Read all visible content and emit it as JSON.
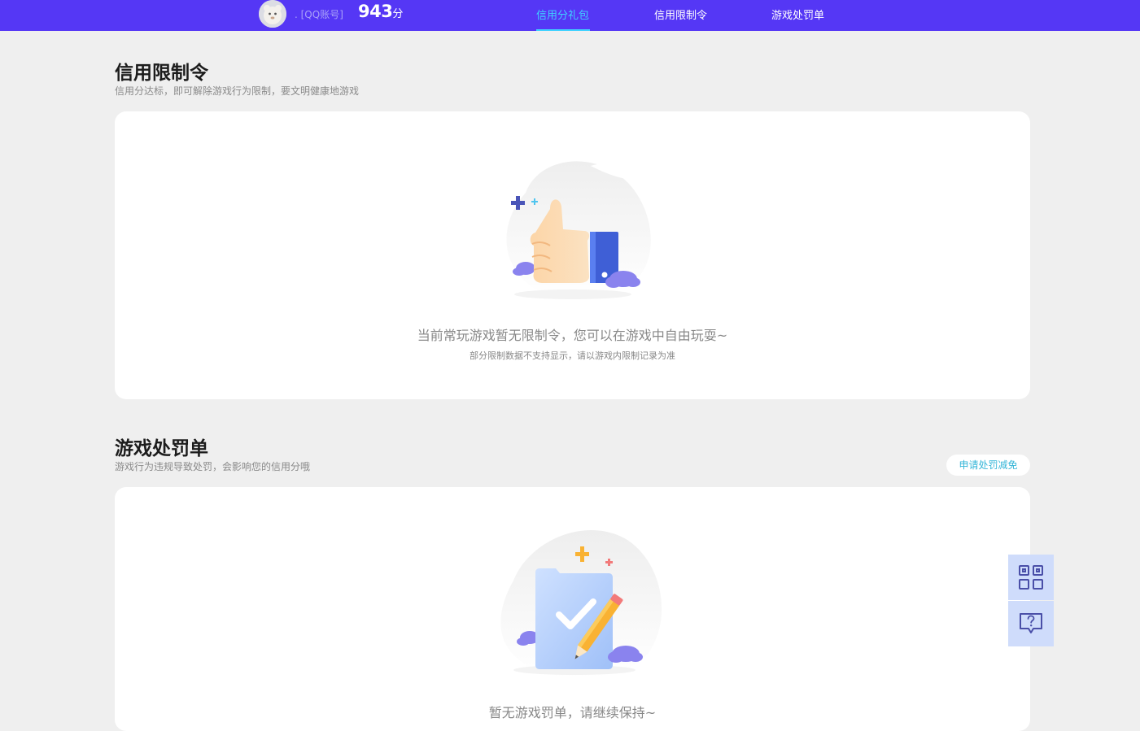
{
  "header": {
    "account_label": ". [QQ账号]",
    "score": "943",
    "score_unit": "分",
    "nav": [
      {
        "label": "信用分礼包",
        "active": true
      },
      {
        "label": "信用限制令",
        "active": false
      },
      {
        "label": "游戏处罚单",
        "active": false
      }
    ]
  },
  "restriction": {
    "title": "信用限制令",
    "subtitle": "信用分达标，即可解除游戏行为限制，要文明健康地游戏",
    "empty_message": "当前常玩游戏暂无限制令，您可以在游戏中自由玩耍~",
    "empty_note": "部分限制数据不支持显示，请以游戏内限制记录为准"
  },
  "penalty": {
    "title": "游戏处罚单",
    "subtitle": "游戏行为违规导致处罚，会影响您的信用分哦",
    "appeal_button": "申请处罚减免",
    "empty_message": "暂无游戏罚单，请继续保持~"
  },
  "side_buttons": [
    {
      "icon": "qr-code-icon"
    },
    {
      "icon": "help-chat-icon"
    }
  ],
  "colors": {
    "brand": "#5537f5",
    "nav_active": "#3fd2ff",
    "page_bg": "#efefef",
    "link": "#35b6d8",
    "side_button_bg": "#cfdcfb"
  }
}
